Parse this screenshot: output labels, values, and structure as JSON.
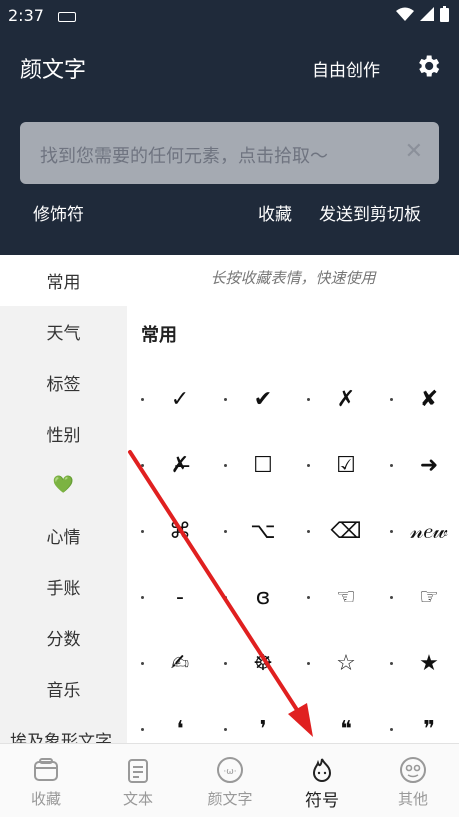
{
  "status": {
    "time": "2:37"
  },
  "appbar": {
    "title": "颜文字",
    "free_create": "自由创作"
  },
  "search": {
    "placeholder": "找到您需要的任何元素，点击拾取～",
    "clear": "✕"
  },
  "actions": {
    "modifier": "修饰符",
    "favorite": "收藏",
    "send_clipboard": "发送到剪切板"
  },
  "sidebar": {
    "items": [
      {
        "label": "常用"
      },
      {
        "label": "天气"
      },
      {
        "label": "标签"
      },
      {
        "label": "性别"
      },
      {
        "label": "💚"
      },
      {
        "label": "心情"
      },
      {
        "label": "手账"
      },
      {
        "label": "分数"
      },
      {
        "label": "音乐"
      },
      {
        "label": "埃及象形文字"
      }
    ]
  },
  "content": {
    "hint": "长按收藏表情，快速使用",
    "section_title": "常用",
    "symbols": [
      "✓",
      "✔",
      "✗",
      "✘",
      "✗̶",
      "☐",
      "☑",
      "➜",
      "⌘",
      "⌥",
      "⌫",
      "𝓃𝑒𝓌",
      "-",
      "ɞ",
      "☜",
      "☞",
      "✍",
      "☸",
      "☆",
      "★",
      "❛",
      "❜",
      "❝",
      "❞"
    ]
  },
  "bottomnav": {
    "items": [
      {
        "label": "收藏"
      },
      {
        "label": "文本"
      },
      {
        "label": "颜文字"
      },
      {
        "label": "符号"
      },
      {
        "label": "其他"
      }
    ]
  },
  "colors": {
    "header_bg": "#1f2a3a",
    "search_bg": "#a5aab2",
    "sidebar_bg": "#f2f2f2",
    "arrow": "#e02020"
  }
}
